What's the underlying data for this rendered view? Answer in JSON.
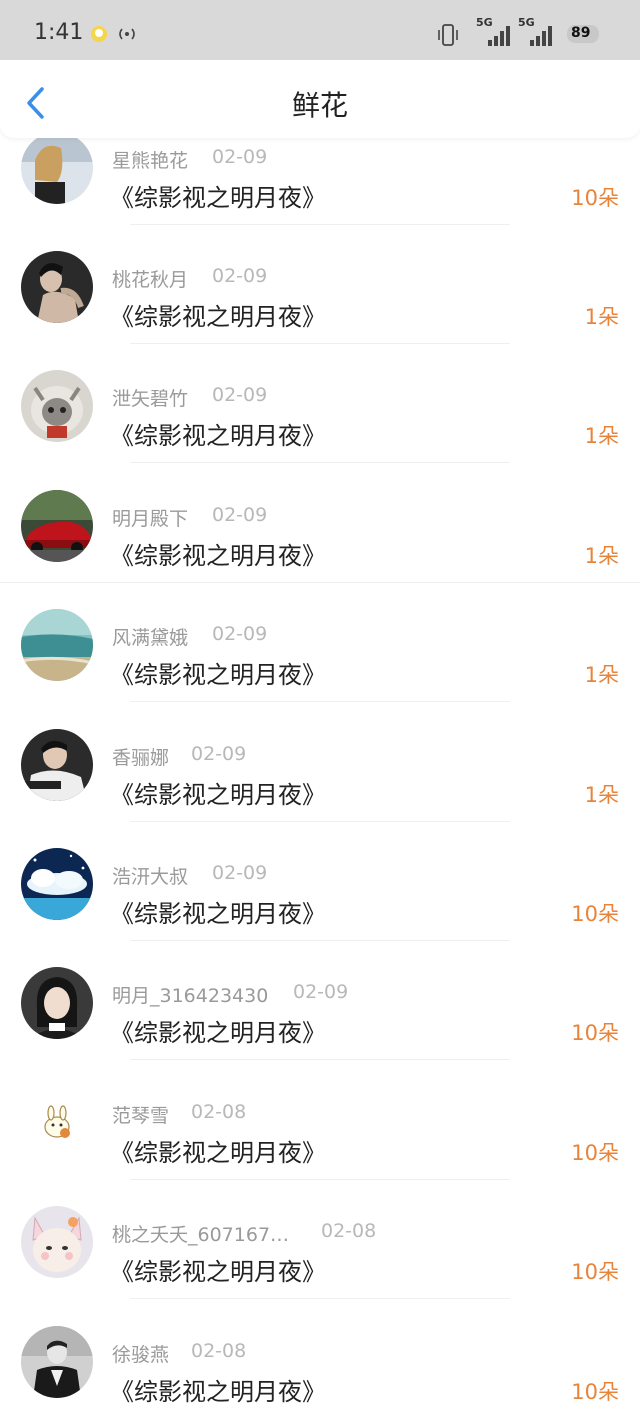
{
  "status_bar": {
    "time": "1:41",
    "network_1": "5G",
    "network_2": "5G",
    "battery": "89"
  },
  "header": {
    "title": "鲜花",
    "back_icon": "chevron-left-icon"
  },
  "colors": {
    "accent": "#3b8fe8",
    "count": "#e8843a"
  },
  "items": [
    {
      "nickname": "星熊艳花",
      "date": "02-09",
      "book": "《综影视之明月夜》",
      "count": "10朵"
    },
    {
      "nickname": "桃花秋月",
      "date": "02-09",
      "book": "《综影视之明月夜》",
      "count": "1朵"
    },
    {
      "nickname": "泄矢碧竹",
      "date": "02-09",
      "book": "《综影视之明月夜》",
      "count": "1朵"
    },
    {
      "nickname": "明月殿下",
      "date": "02-09",
      "book": "《综影视之明月夜》",
      "count": "1朵"
    },
    {
      "nickname": "风满黛娥",
      "date": "02-09",
      "book": "《综影视之明月夜》",
      "count": "1朵"
    },
    {
      "nickname": "香骊娜",
      "date": "02-09",
      "book": "《综影视之明月夜》",
      "count": "1朵"
    },
    {
      "nickname": "浩汧大叔",
      "date": "02-09",
      "book": "《综影视之明月夜》",
      "count": "10朵"
    },
    {
      "nickname": "明月_316423430",
      "date": "02-09",
      "book": "《综影视之明月夜》",
      "count": "10朵"
    },
    {
      "nickname": "范琴雪",
      "date": "02-08",
      "book": "《综影视之明月夜》",
      "count": "10朵"
    },
    {
      "nickname": "桃之夭夭_607167…",
      "date": "02-08",
      "book": "《综影视之明月夜》",
      "count": "10朵"
    },
    {
      "nickname": "徐骏燕",
      "date": "02-08",
      "book": "《综影视之明月夜》",
      "count": "10朵"
    }
  ]
}
